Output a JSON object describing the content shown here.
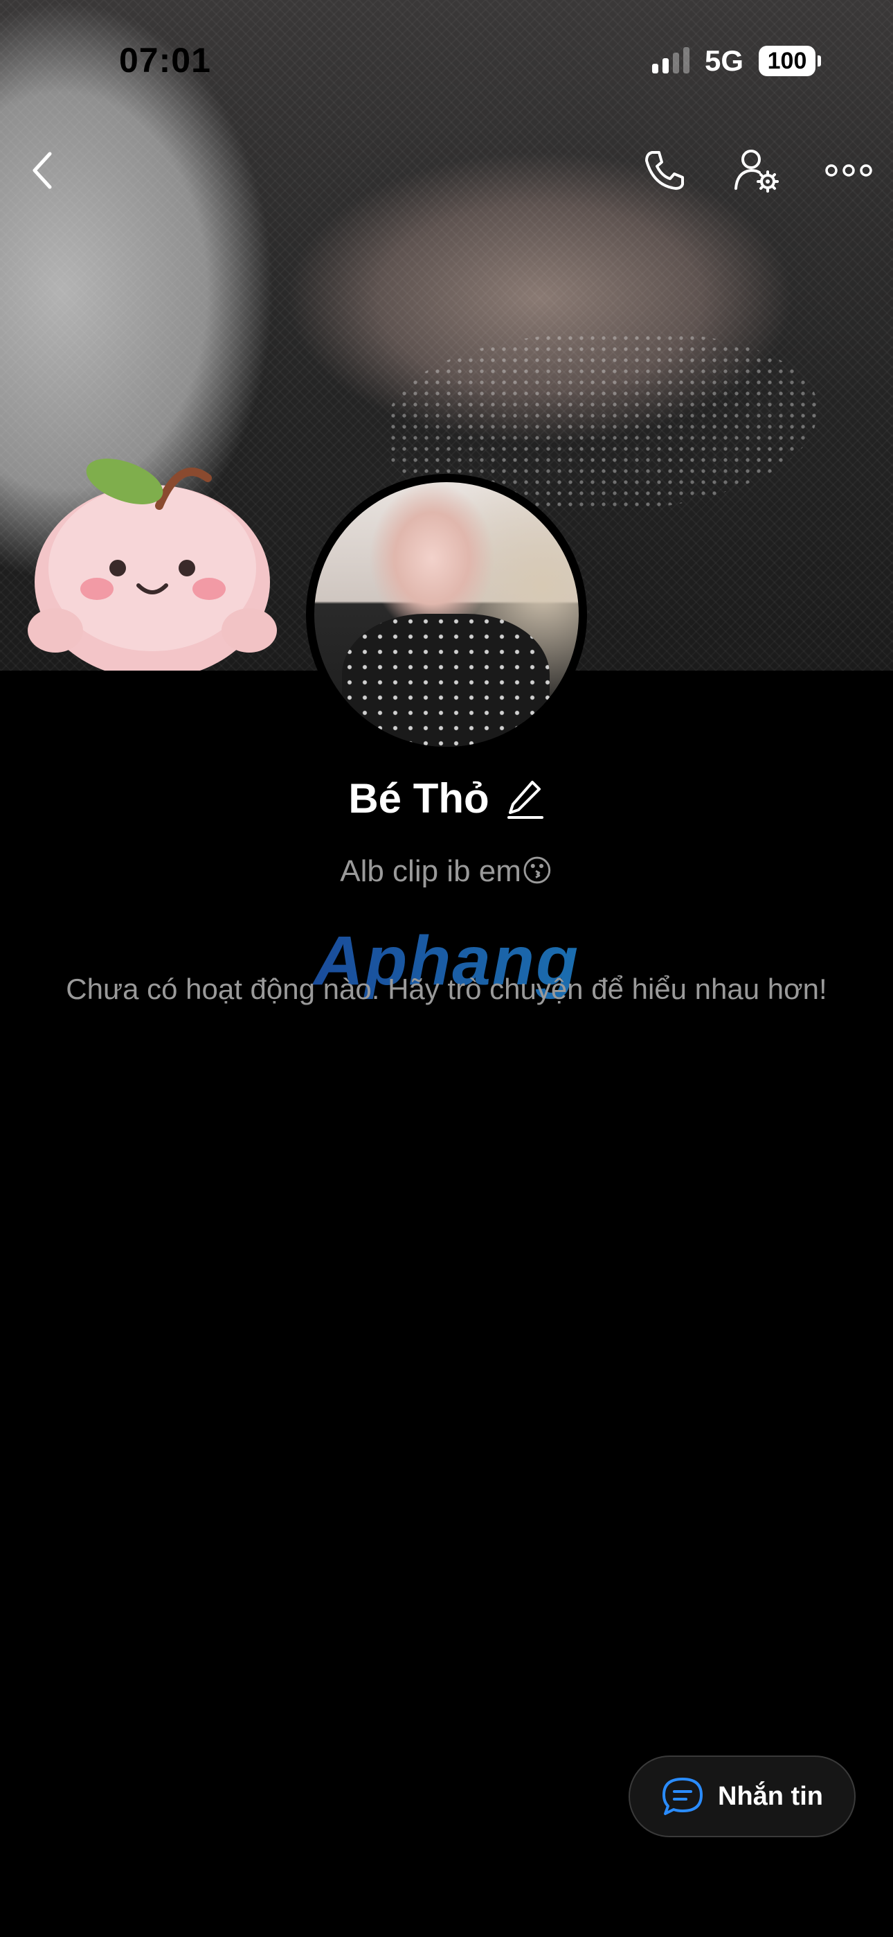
{
  "status_bar": {
    "time": "07:01",
    "network": "5G",
    "battery": "100"
  },
  "nav": {
    "back_icon": "chevron-left-icon",
    "call_icon": "phone-icon",
    "settings_icon": "user-settings-icon",
    "more_icon": "more-dots-icon"
  },
  "profile": {
    "name": "Bé Thỏ",
    "bio": "Alb clip ib em😗",
    "empty_activity": "Chưa có hoạt động nào. Hãy trò chuyện để hiểu nhau hơn!"
  },
  "watermark": "Aphang",
  "message_button": {
    "label": "Nhắn tin",
    "icon": "chat-bubble-icon"
  },
  "colors": {
    "background": "#000000",
    "muted_text": "#9a9a9a",
    "accent": "#2a8cff"
  }
}
